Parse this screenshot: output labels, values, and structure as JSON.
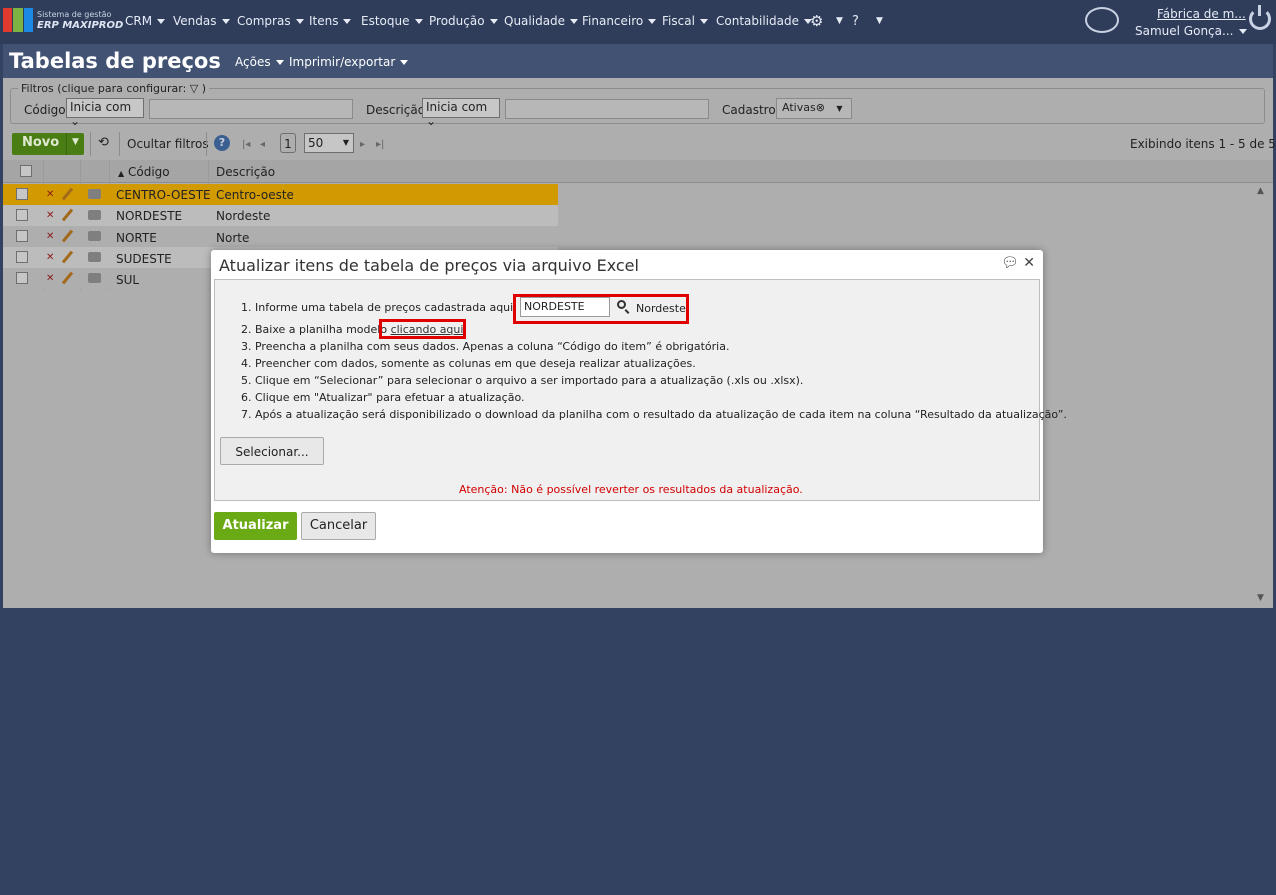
{
  "app": {
    "logo_line1": "Sistema de gestão",
    "logo_line2": "ERP MAXIPROD",
    "logo_colors": [
      "#e03a2f",
      "#7cb342",
      "#1e88e5"
    ]
  },
  "nav": {
    "items": [
      "CRM",
      "Vendas",
      "Compras",
      "Itens",
      "Estoque",
      "Produção",
      "Qualidade",
      "Financeiro",
      "Fiscal",
      "Contabilidade"
    ],
    "gear_icon": "gear-icon",
    "help_icon": "help-icon",
    "chat_icon": "chat-icon",
    "company": "Fábrica de m...",
    "user": "Samuel Gonça...",
    "power_icon": "power-icon"
  },
  "page": {
    "title": "Tabelas de preços",
    "menu_actions": "Ações",
    "menu_print": "Imprimir/exportar"
  },
  "filters": {
    "legend": "Filtros (clique para configurar:",
    "legend_end": ")",
    "code_label": "Código",
    "code_mode": "Inicia com",
    "desc_label": "Descrição",
    "desc_mode": "Inicia com",
    "status_label": "Cadastro",
    "status_tag": "Ativas"
  },
  "toolbar": {
    "new_label": "Novo",
    "hide_filters": "Ocultar filtros",
    "page_number": "1",
    "page_size": "50",
    "showing": "Exibindo itens 1 - 5 de 5"
  },
  "grid": {
    "col_code": "Código",
    "col_desc": "Descrição",
    "rows": [
      {
        "code": "CENTRO-OESTE",
        "desc": "Centro-oeste"
      },
      {
        "code": "NORDESTE",
        "desc": "Nordeste"
      },
      {
        "code": "NORTE",
        "desc": "Norte"
      },
      {
        "code": "SUDESTE",
        "desc": ""
      },
      {
        "code": "SUL",
        "desc": ""
      }
    ]
  },
  "modal": {
    "title": "Atualizar itens de tabela de preços via arquivo Excel",
    "step1": "1. Informe uma tabela de preços cadastrada aqui:",
    "code_value": "NORDESTE",
    "lookup_name": "Nordeste",
    "step2_pre": "2. Baixe a planilha modelo",
    "step2_link": "clicando aqui",
    "step2_post": ".",
    "step3": "3. Preencha a planilha com seus dados. Apenas a coluna “Código do item” é obrigatória.",
    "step4": "4. Preencher com dados, somente as colunas em que deseja realizar atualizações.",
    "step5": "5. Clique em “Selecionar” para selecionar o arquivo a ser importado para a atualização (.xls ou .xlsx).",
    "step6": "6. Clique em \"Atualizar\" para efetuar a atualização.",
    "step7": "7. Após a atualização será disponibilizado o download da planilha com o resultado da atualização de cada item na coluna “Resultado da atualização”.",
    "select_button": "Selecionar...",
    "warning": "Atenção: Não é possível reverter os resultados da atualização.",
    "update_button": "Atualizar",
    "cancel_button": "Cancelar"
  }
}
